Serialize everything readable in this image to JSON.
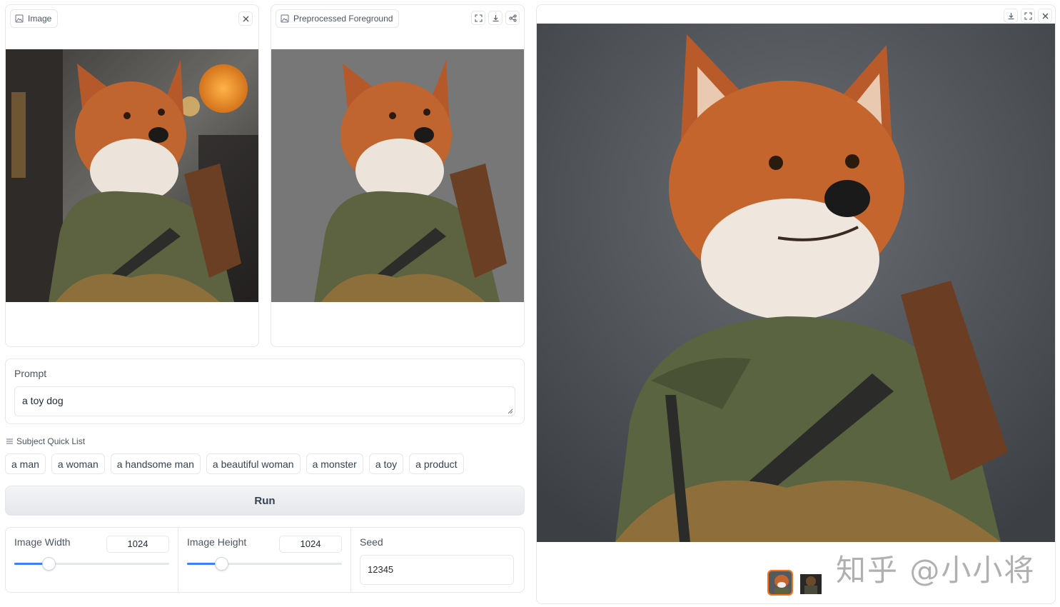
{
  "input_image": {
    "label": "Image",
    "icons": [
      "image-icon",
      "close-icon"
    ]
  },
  "foreground": {
    "label": "Preprocessed Foreground",
    "icons": [
      "image-icon",
      "fullscreen-icon",
      "download-icon",
      "share-icon"
    ]
  },
  "output": {
    "icons": [
      "download-icon",
      "fullscreen-icon",
      "close-icon"
    ]
  },
  "prompt": {
    "label": "Prompt",
    "value": "a toy dog"
  },
  "quick_list": {
    "title": "Subject Quick List",
    "items": [
      "a man",
      "a woman",
      "a handsome man",
      "a beautiful woman",
      "a monster",
      "a toy",
      "a product"
    ]
  },
  "run": {
    "label": "Run"
  },
  "settings": {
    "width": {
      "label": "Image Width",
      "value": "1024",
      "fraction": 0.22
    },
    "height": {
      "label": "Image Height",
      "value": "1024",
      "fraction": 0.22
    },
    "seed": {
      "label": "Seed",
      "value": "12345"
    }
  },
  "watermark": "知乎 @小小将",
  "colors": {
    "accent": "#3b82f6",
    "border": "#e5e7eb",
    "run_bg": "#e5e7eb"
  }
}
